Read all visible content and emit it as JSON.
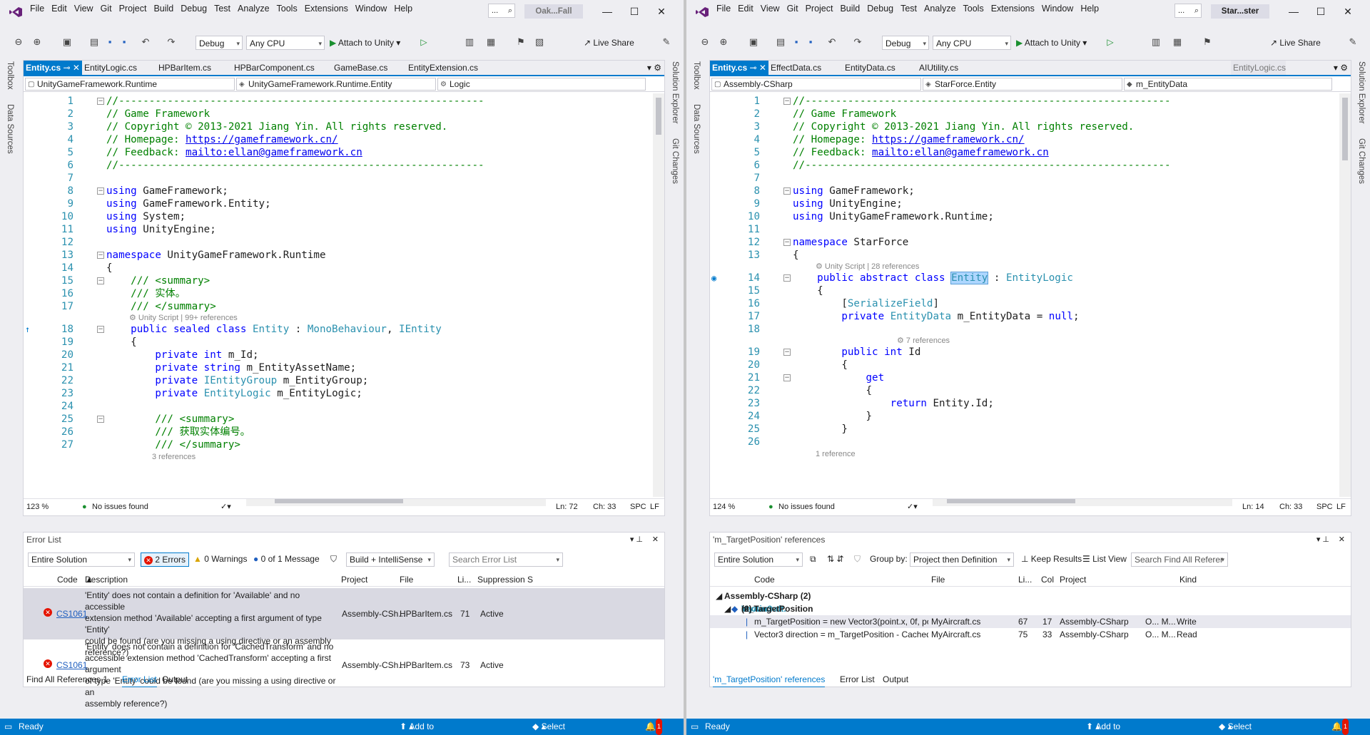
{
  "menu": [
    "File",
    "Edit",
    "View",
    "Git",
    "Project",
    "Build",
    "Debug",
    "Test",
    "Analyze",
    "Tools",
    "Extensions",
    "Window",
    "Help"
  ],
  "colors": {
    "accent": "#007acc",
    "error": "#e51400",
    "comment": "#008000",
    "keyword": "#0000ff",
    "type": "#2b91af"
  },
  "toolbar": {
    "config": "Debug",
    "platform": "Any CPU",
    "attach": "Attach to Unity",
    "liveshare": "Live Share"
  },
  "sidebars": {
    "left": [
      "Toolbox",
      "Data Sources"
    ],
    "right": [
      "Solution Explorer",
      "Git Changes"
    ]
  },
  "left": {
    "title_short": "Oak...Fall",
    "tabs": [
      "Entity.cs",
      "EntityLogic.cs",
      "HPBarItem.cs",
      "HPBarComponent.cs",
      "GameBase.cs",
      "EntityExtension.cs"
    ],
    "nav": [
      "UnityGameFramework.Runtime",
      "UnityGameFramework.Runtime.Entity",
      "Logic"
    ],
    "lines": [
      {
        "n": "1",
        "html": "<span class='c'>//------------------------------------------------------------</span>",
        "fold": "-"
      },
      {
        "n": "2",
        "html": "<span class='c'>// Game Framework</span>"
      },
      {
        "n": "3",
        "html": "<span class='c'>// Copyright © 2013-2021 Jiang Yin. All rights reserved.</span>"
      },
      {
        "n": "4",
        "html": "<span class='c'>// Homepage: </span><span class='l'>https://gameframework.cn/</span>"
      },
      {
        "n": "5",
        "html": "<span class='c'>// Feedback: </span><span class='l'>mailto:ellan@gameframework.cn</span>"
      },
      {
        "n": "6",
        "html": "<span class='c'>//------------------------------------------------------------</span>"
      },
      {
        "n": "7",
        "html": ""
      },
      {
        "n": "8",
        "html": "<span class='k'>using</span> GameFramework;",
        "fold": "-"
      },
      {
        "n": "9",
        "html": "<span class='k'>using</span> GameFramework.Entity;"
      },
      {
        "n": "10",
        "html": "<span class='k'>using</span> System;"
      },
      {
        "n": "11",
        "html": "<span class='k'>using</span> UnityEngine;"
      },
      {
        "n": "12",
        "html": ""
      },
      {
        "n": "13",
        "html": "<span class='k'>namespace</span> UnityGameFramework.Runtime",
        "fold": "-"
      },
      {
        "n": "14",
        "html": "{"
      },
      {
        "n": "15",
        "html": "    <span class='c'>/// &lt;summary&gt;</span>",
        "fold": "-"
      },
      {
        "n": "16",
        "html": "    <span class='c'>/// 实体。</span>"
      },
      {
        "n": "17",
        "html": "    <span class='c'>/// &lt;/summary&gt;</span>"
      },
      {
        "n": "18",
        "html": "    <span class='k'>public sealed class</span> <span class='t'>Entity</span> : <span class='t'>MonoBehaviour</span>, <span class='t'>IEntity</span>",
        "fold": "-",
        "hint": "Unity Script | 99+ references",
        "mark": "↑"
      },
      {
        "n": "19",
        "html": "    {"
      },
      {
        "n": "20",
        "html": "        <span class='k'>private int</span> m_Id;"
      },
      {
        "n": "21",
        "html": "        <span class='k'>private string</span> m_EntityAssetName;"
      },
      {
        "n": "22",
        "html": "        <span class='k'>private</span> <span class='t'>IEntityGroup</span> m_EntityGroup;"
      },
      {
        "n": "23",
        "html": "        <span class='k'>private</span> <span class='t'>EntityLogic</span> m_EntityLogic;"
      },
      {
        "n": "24",
        "html": ""
      },
      {
        "n": "25",
        "html": "        <span class='c'>/// &lt;summary&gt;</span>",
        "fold": "-"
      },
      {
        "n": "26",
        "html": "        <span class='c'>/// 获取实体编号。</span>"
      },
      {
        "n": "27",
        "html": "        <span class='c'>/// &lt;/summary&gt;</span>"
      }
    ],
    "trailing_hint": "3 references",
    "status": {
      "zoom": "123 %",
      "issues": "No issues found",
      "ln": "Ln: 72",
      "ch": "Ch: 33",
      "spc": "SPC",
      "lf": "LF"
    },
    "panel": {
      "title": "Error List",
      "scope": "Entire Solution",
      "errors": "2 Errors",
      "warnings": "0 Warnings",
      "messages": "0 of 1 Message",
      "build": "Build + IntelliSense",
      "search": "Search Error List",
      "headers": [
        "Code",
        "Description",
        "Project",
        "File",
        "Li...",
        "Suppression S"
      ],
      "rows": [
        {
          "code": "CS1061",
          "desc": [
            "'Entity' does not contain a definition for 'Available' and no accessible",
            "extension method 'Available' accepting a first argument of type 'Entity'",
            "could be found (are you missing a using directive or an assembly",
            "reference?)"
          ],
          "project": "Assembly-CSh...",
          "file": "HPBarItem.cs",
          "line": "71",
          "supp": "Active"
        },
        {
          "code": "CS1061",
          "desc": [
            "'Entity' does not contain a definition for 'CachedTransform' and no",
            "accessible extension method 'CachedTransform' accepting a first argument",
            "of type 'Entity' could be found (are you missing a using directive or an",
            "assembly reference?)"
          ],
          "project": "Assembly-CSh...",
          "file": "HPBarItem.cs",
          "line": "73",
          "supp": "Active"
        }
      ],
      "tabs": [
        "Find All References 1",
        "Error List",
        "Output"
      ]
    }
  },
  "right": {
    "title_short": "Star...ster",
    "tabs": [
      "Entity.cs",
      "EffectData.cs",
      "EntityData.cs",
      "AIUtility.cs"
    ],
    "preview_tab": "EntityLogic.cs",
    "nav": [
      "Assembly-CSharp",
      "StarForce.Entity",
      "m_EntityData"
    ],
    "lines": [
      {
        "n": "1",
        "html": "<span class='c'>//------------------------------------------------------------</span>",
        "fold": "-"
      },
      {
        "n": "2",
        "html": "<span class='c'>// Game Framework</span>"
      },
      {
        "n": "3",
        "html": "<span class='c'>// Copyright © 2013-2021 Jiang Yin. All rights reserved.</span>"
      },
      {
        "n": "4",
        "html": "<span class='c'>// Homepage: </span><span class='l'>https://gameframework.cn/</span>"
      },
      {
        "n": "5",
        "html": "<span class='c'>// Feedback: </span><span class='l'>mailto:ellan@gameframework.cn</span>"
      },
      {
        "n": "6",
        "html": "<span class='c'>//------------------------------------------------------------</span>"
      },
      {
        "n": "7",
        "html": ""
      },
      {
        "n": "8",
        "html": "<span class='k'>using</span> GameFramework;",
        "fold": "-"
      },
      {
        "n": "9",
        "html": "<span class='k'>using</span> UnityEngine;"
      },
      {
        "n": "10",
        "html": "<span class='k'>using</span> UnityGameFramework.Runtime;"
      },
      {
        "n": "11",
        "html": ""
      },
      {
        "n": "12",
        "html": "<span class='k'>namespace</span> StarForce",
        "fold": "-"
      },
      {
        "n": "13",
        "html": "{"
      },
      {
        "n": "14",
        "html": "    <span class='k'>public abstract class</span> <span class='t sel'>Entity</span> : <span class='t'>EntityLogic</span>",
        "fold": "-",
        "hint": "Unity Script | 28 references",
        "mark": "◉"
      },
      {
        "n": "15",
        "html": "    {"
      },
      {
        "n": "16",
        "html": "        [<span class='t'>SerializeField</span>]"
      },
      {
        "n": "17",
        "html": "        <span class='k'>private</span> <span class='t'>EntityData</span> m_EntityData = <span class='k'>null</span>;"
      },
      {
        "n": "18",
        "html": ""
      },
      {
        "n": "19",
        "html": "        <span class='k'>public int</span> Id",
        "fold": "-",
        "hint": "7 references"
      },
      {
        "n": "20",
        "html": "        {"
      },
      {
        "n": "21",
        "html": "            <span class='k'>get</span>",
        "fold": "-"
      },
      {
        "n": "22",
        "html": "            {"
      },
      {
        "n": "23",
        "html": "                <span class='k'>return</span> Entity.Id;"
      },
      {
        "n": "24",
        "html": "            }"
      },
      {
        "n": "25",
        "html": "        }"
      },
      {
        "n": "26",
        "html": ""
      }
    ],
    "trailing_hint": "1 reference",
    "status": {
      "zoom": "124 %",
      "issues": "No issues found",
      "ln": "Ln: 14",
      "ch": "Ch: 33",
      "spc": "SPC",
      "lf": "LF"
    },
    "panel": {
      "title": "'m_TargetPosition' references",
      "scope": "Entire Solution",
      "groupby_label": "Group by:",
      "groupby": "Project then Definition",
      "keep": "Keep Results",
      "listview": "List View",
      "search": "Search Find All Referer",
      "headers": [
        "Code",
        "File",
        "Li...",
        "Col",
        "Project",
        "Kind"
      ],
      "group": "Assembly-CSharp (2)",
      "def_type": "Vector3",
      "def_prefix": "MyAircraft.",
      "def_name": "m_TargetPosition",
      "def_count": "(2)",
      "rows": [
        {
          "code": "m_TargetPosition = new Vector3(point.x, 0f, point....",
          "file": "MyAircraft.cs",
          "line": "67",
          "col": "17",
          "project": "Assembly-CSharp",
          "o": "O... M...",
          "kind": "Write"
        },
        {
          "code": "Vector3 direction = m_TargetPosition - CachedTr...",
          "file": "MyAircraft.cs",
          "line": "75",
          "col": "33",
          "project": "Assembly-CSharp",
          "o": "O... M...",
          "kind": "Read"
        }
      ],
      "tabs": [
        "'m_TargetPosition' references",
        "Error List",
        "Output"
      ]
    }
  },
  "statusbar": {
    "ready": "Ready",
    "source": "Add to Source Control",
    "repo": "Select Repository",
    "notif": "1"
  }
}
